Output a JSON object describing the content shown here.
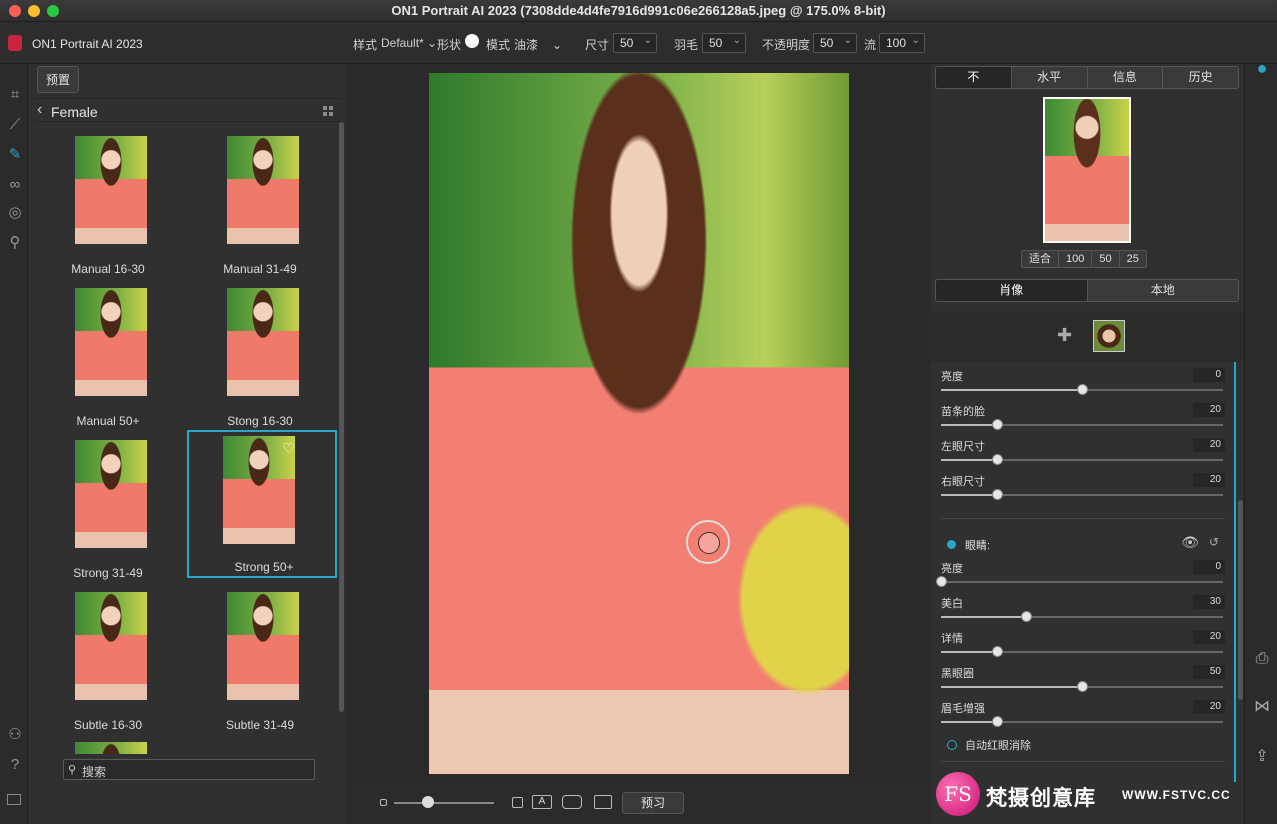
{
  "window": {
    "title": "ON1 Portrait AI 2023 (7308dde4d4fe7916d991c06e266128a5.jpeg @ 175.0% 8-bit)"
  },
  "toolbar": {
    "app_name": "ON1 Portrait AI 2023",
    "style_label": "样式",
    "style_value": "Default*",
    "shape_label": "形状",
    "mode_label": "模式",
    "mode_value": "油漆",
    "size_label": "尺寸",
    "size_value": "50",
    "feather_label": "羽毛",
    "feather_value": "50",
    "opacity_label": "不透明度",
    "opacity_value": "50",
    "flow_label": "流",
    "flow_value": "100"
  },
  "browser": {
    "preset_button": "预置",
    "breadcrumb": "Female",
    "presets": [
      {
        "label": "Manual 16-30"
      },
      {
        "label": "Manual 31-49"
      },
      {
        "label": "Manual 50+"
      },
      {
        "label": "Stong 16-30"
      },
      {
        "label": "Strong 31-49"
      },
      {
        "label": "Strong 50+",
        "selected": true
      },
      {
        "label": "Subtle 16-30"
      },
      {
        "label": "Subtle 31-49"
      }
    ],
    "search_placeholder": "搜索"
  },
  "bottom": {
    "preview_button": "预习",
    "text_overlay_glyph": "A"
  },
  "right": {
    "tabs": [
      "不",
      "水平",
      "信息",
      "历史"
    ],
    "active_tab": 0,
    "zoom_buttons": [
      "适合",
      "100",
      "50",
      "25"
    ],
    "mode_tabs": [
      "肖像",
      "本地"
    ],
    "active_mode_tab": 0,
    "face_sliders": [
      {
        "label": "亮度",
        "value": 0,
        "position": 0.5
      },
      {
        "label": "苗条的脸",
        "value": 20,
        "position": 0.2
      },
      {
        "label": "左眼尺寸",
        "value": 20,
        "position": 0.2
      },
      {
        "label": "右眼尺寸",
        "value": 20,
        "position": 0.2
      }
    ],
    "eyes_section": "眼睛:",
    "eye_sliders": [
      {
        "label": "亮度",
        "value": 0,
        "position": 0.0
      },
      {
        "label": "美白",
        "value": 30,
        "position": 0.3
      },
      {
        "label": "详情",
        "value": 20,
        "position": 0.2
      },
      {
        "label": "黑眼圈",
        "value": 50,
        "position": 0.5
      },
      {
        "label": "眉毛增强",
        "value": 20,
        "position": 0.2
      }
    ],
    "auto_redeye": "自动红眼消除"
  },
  "watermark": {
    "logo": "FS",
    "text": "梵摄创意库",
    "url": "WWW.FSTVC.CC"
  },
  "colors": {
    "accent": "#2aa6c9",
    "selected_border": "#2aa6c9",
    "app_red": "#c8263e"
  }
}
